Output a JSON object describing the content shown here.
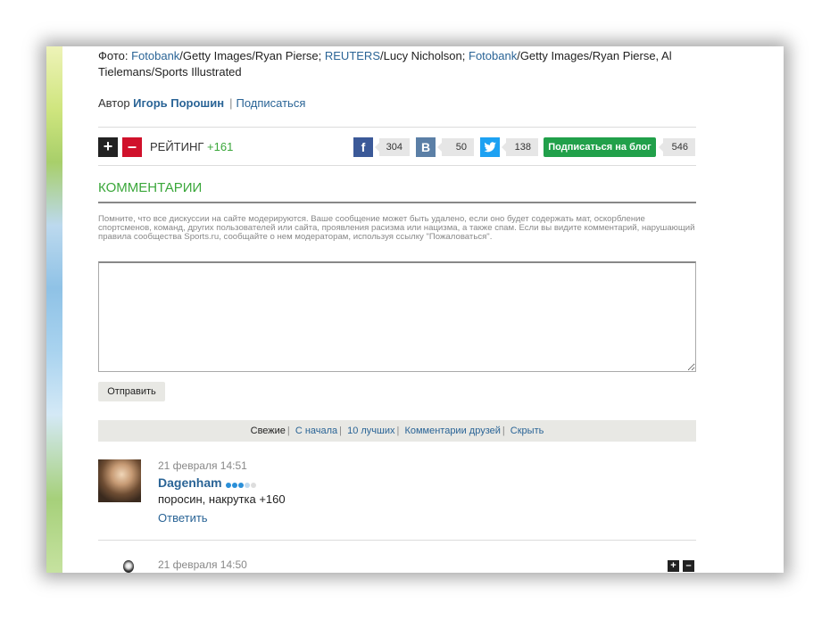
{
  "photo_credit": {
    "prefix": "Фото: ",
    "link1": "Fotobank",
    "text1": "/Getty Images/Ryan Pierse; ",
    "link2": "REUTERS",
    "text2": "/Lucy Nicholson; ",
    "link3": "Fotobank",
    "text3": "/Getty Images/Ryan Pierse, Al Tielemans/Sports Illustrated"
  },
  "author": {
    "label": "Автор ",
    "name": "Игорь Порошин",
    "separator": "|",
    "subscribe": "Подписаться"
  },
  "rating": {
    "plus_icon": "+",
    "minus_icon": "–",
    "label": "РЕЙТИНГ ",
    "value": "+161"
  },
  "share": {
    "facebook": {
      "icon": "f",
      "count": "304",
      "color": "#3b5998"
    },
    "vkontakte": {
      "icon": "В",
      "count": "50",
      "color": "#5b7fa6"
    },
    "twitter": {
      "icon": "twitter-bird",
      "count": "138",
      "color": "#1da1f2"
    },
    "subscribe_blog": {
      "label": "Подписаться на блог",
      "count": "546",
      "color": "#21a04a"
    }
  },
  "comments": {
    "title": "КОММЕНТАРИИ",
    "notice": "Помните, что все дискуссии на сайте модерируются. Ваше сообщение может быть удалено, если оно будет содержать мат, оскорбление спортсменов, команд, других пользователей или сайта, проявления расизма или нацизма, а также спам. Если вы видите комментарий, нарушающий правила сообщества Sports.ru, сообщайте о нем модераторам, используя ссылку \"Пожаловаться\".",
    "textarea_value": "",
    "send_label": "Отправить",
    "filters": [
      "Свежие",
      "С начала",
      "10 лучших",
      "Комментарии друзей",
      "Скрыть"
    ],
    "items": [
      {
        "date": "21 февраля 14:51",
        "author": "Dagenham",
        "text": "поросин, накрутка +160",
        "reply": "Ответить",
        "level_dots": [
          "#2a8fd8",
          "#2a8fd8",
          "#2a8fd8",
          "#bfd9ee",
          "#dddddd"
        ]
      },
      {
        "date": "21 февраля 14:50"
      }
    ]
  }
}
